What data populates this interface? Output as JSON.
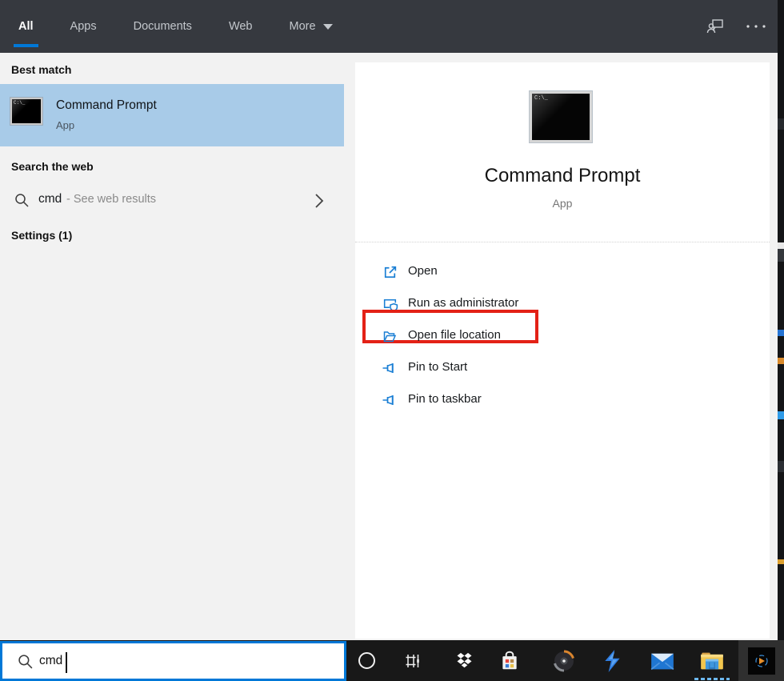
{
  "nav": {
    "tabs": [
      {
        "label": "All",
        "active": true
      },
      {
        "label": "Apps",
        "active": false
      },
      {
        "label": "Documents",
        "active": false
      },
      {
        "label": "Web",
        "active": false
      },
      {
        "label": "More",
        "active": false,
        "has_dropdown": true
      }
    ],
    "icons": [
      "feedback-icon",
      "more-options-icon"
    ]
  },
  "left_panel": {
    "best_match_header": "Best match",
    "best_match": {
      "title": "Command Prompt",
      "subtitle": "App",
      "icon": "cmd-icon",
      "selected": true
    },
    "web_header": "Search the web",
    "web_row": {
      "query": "cmd",
      "suffix": "- See web results",
      "icon": "search-icon",
      "chevron": "chevron-right-icon"
    },
    "settings_header": "Settings (1)"
  },
  "right_panel": {
    "app_icon": "cmd-icon",
    "app_icon_text": "C:\\_",
    "title": "Command Prompt",
    "subtitle": "App",
    "actions": [
      {
        "label": "Open",
        "icon": "open-icon",
        "highlighted": false
      },
      {
        "label": "Run as administrator",
        "icon": "admin-shield-icon",
        "highlighted": true
      },
      {
        "label": "Open file location",
        "icon": "folder-icon",
        "highlighted": false
      },
      {
        "label": "Pin to Start",
        "icon": "pin-icon",
        "highlighted": false
      },
      {
        "label": "Pin to taskbar",
        "icon": "pin-icon",
        "highlighted": false
      }
    ],
    "annotation_color": "#e32116"
  },
  "search_bar": {
    "value": "cmd",
    "icon": "search-icon",
    "border_color": "#0078d7"
  },
  "taskbar": {
    "icons": [
      "cortana",
      "task-view",
      "dropbox",
      "microsoft-store",
      "music-disc",
      "lightning",
      "mail",
      "file-explorer",
      "active-app"
    ],
    "active_pinned": "file-explorer"
  },
  "colors": {
    "nav_bg": "#36393f",
    "accent": "#0078d7",
    "selection_blue": "#a8cbe8",
    "panel_gray": "#f2f2f2",
    "action_icon_blue": "#1a7fd4",
    "annotation_red": "#e32116",
    "taskbar_bg": "#181818"
  }
}
